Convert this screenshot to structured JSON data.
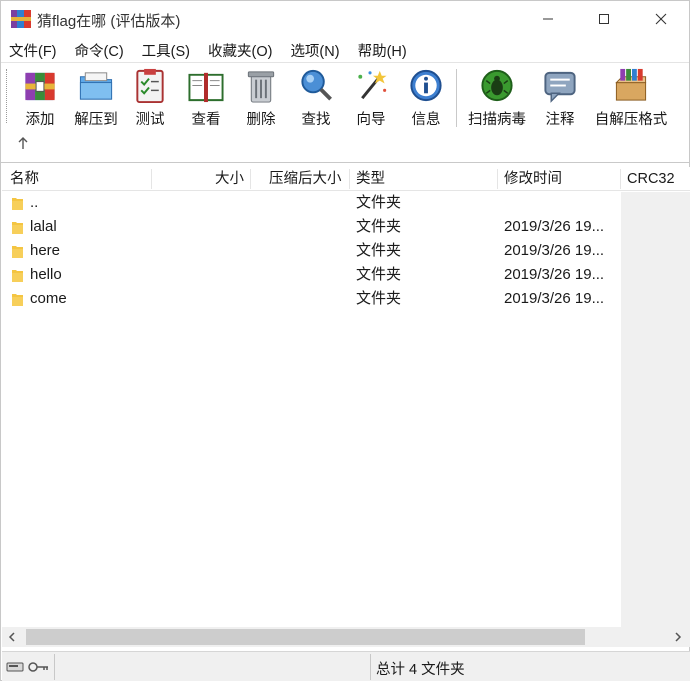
{
  "window": {
    "title": "猜flag在哪 (评估版本)",
    "icon": "winrar-app-icon"
  },
  "menu": [
    "文件(F)",
    "命令(C)",
    "工具(S)",
    "收藏夹(O)",
    "选项(N)",
    "帮助(H)"
  ],
  "toolbar": {
    "add": "添加",
    "extract": "解压到",
    "test": "测试",
    "view": "查看",
    "delete": "删除",
    "find": "查找",
    "wizard": "向导",
    "info": "信息",
    "scan": "扫描病毒",
    "comment": "注释",
    "sfx": "自解压格式",
    "up_icon": "up-arrow-icon"
  },
  "columns": {
    "name": "名称",
    "size": "大小",
    "packed": "压缩后大小",
    "type": "类型",
    "modified": "修改时间",
    "crc": "CRC32"
  },
  "rows": [
    {
      "name": "..",
      "type": "文件夹",
      "modified": ""
    },
    {
      "name": "lalal",
      "type": "文件夹",
      "modified": "2019/3/26 19..."
    },
    {
      "name": "here",
      "type": "文件夹",
      "modified": "2019/3/26 19..."
    },
    {
      "name": "hello",
      "type": "文件夹",
      "modified": "2019/3/26 19..."
    },
    {
      "name": "come",
      "type": "文件夹",
      "modified": "2019/3/26 19..."
    }
  ],
  "status": {
    "summary": "总计 4 文件夹"
  },
  "colors": {
    "folder": "#f4c542",
    "statusbar_bg": "#f0f0f0",
    "crc_column_bg": "#f0f0f0"
  }
}
